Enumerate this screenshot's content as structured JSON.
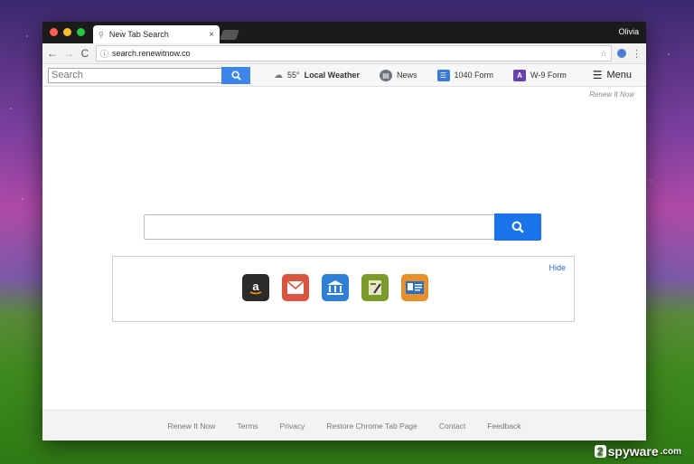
{
  "browser": {
    "tab_title": "New Tab Search",
    "tab_close": "×",
    "user": "Olivia",
    "url": "search.renewitnow.co",
    "nav": {
      "back": "←",
      "forward": "→",
      "reload": "C"
    }
  },
  "toolbar": {
    "search_placeholder": "Search",
    "weather_temp": "55°",
    "weather_label": "Local Weather",
    "items": [
      {
        "label": "News",
        "icon": "newspaper-icon",
        "color": "#6b7380"
      },
      {
        "label": "1040 Form",
        "icon": "bank-icon",
        "color": "#3b7bd4"
      },
      {
        "label": "W-9 Form",
        "icon": "w9-form-icon",
        "color": "#6a3fb0"
      }
    ],
    "menu_label": "Menu"
  },
  "page": {
    "renew_link": "Renew It Now",
    "hide_label": "Hide",
    "shortcuts": [
      {
        "icon": "amazon-icon",
        "color": "#2b2b2b"
      },
      {
        "icon": "mail-icon",
        "color": "#d8553f"
      },
      {
        "icon": "bank-icon",
        "color": "#2f7fd6"
      },
      {
        "icon": "tax-form-icon",
        "color": "#7a9a2a"
      },
      {
        "icon": "id-card-icon",
        "color": "#e8902a"
      }
    ]
  },
  "footer": {
    "links": [
      "Renew It Now",
      "Terms",
      "Privacy",
      "Restore Chrome Tab Page",
      "Contact",
      "Feedback"
    ]
  },
  "watermark": {
    "prefix": "2",
    "text": "spyware",
    "suffix": ".com"
  }
}
